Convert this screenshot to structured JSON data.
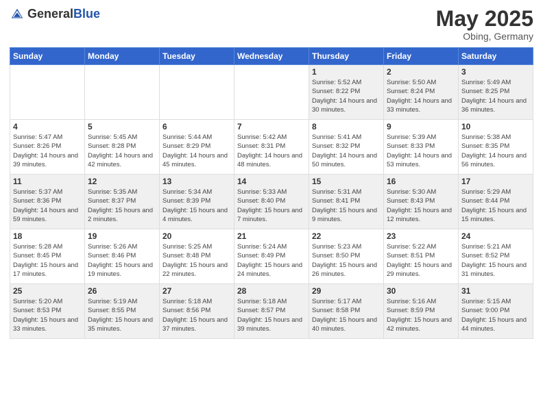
{
  "header": {
    "logo_general": "General",
    "logo_blue": "Blue",
    "month_year": "May 2025",
    "location": "Obing, Germany"
  },
  "days_of_week": [
    "Sunday",
    "Monday",
    "Tuesday",
    "Wednesday",
    "Thursday",
    "Friday",
    "Saturday"
  ],
  "weeks": [
    [
      {
        "num": "",
        "info": ""
      },
      {
        "num": "",
        "info": ""
      },
      {
        "num": "",
        "info": ""
      },
      {
        "num": "",
        "info": ""
      },
      {
        "num": "1",
        "info": "Sunrise: 5:52 AM\nSunset: 8:22 PM\nDaylight: 14 hours\nand 30 minutes."
      },
      {
        "num": "2",
        "info": "Sunrise: 5:50 AM\nSunset: 8:24 PM\nDaylight: 14 hours\nand 33 minutes."
      },
      {
        "num": "3",
        "info": "Sunrise: 5:49 AM\nSunset: 8:25 PM\nDaylight: 14 hours\nand 36 minutes."
      }
    ],
    [
      {
        "num": "4",
        "info": "Sunrise: 5:47 AM\nSunset: 8:26 PM\nDaylight: 14 hours\nand 39 minutes."
      },
      {
        "num": "5",
        "info": "Sunrise: 5:45 AM\nSunset: 8:28 PM\nDaylight: 14 hours\nand 42 minutes."
      },
      {
        "num": "6",
        "info": "Sunrise: 5:44 AM\nSunset: 8:29 PM\nDaylight: 14 hours\nand 45 minutes."
      },
      {
        "num": "7",
        "info": "Sunrise: 5:42 AM\nSunset: 8:31 PM\nDaylight: 14 hours\nand 48 minutes."
      },
      {
        "num": "8",
        "info": "Sunrise: 5:41 AM\nSunset: 8:32 PM\nDaylight: 14 hours\nand 50 minutes."
      },
      {
        "num": "9",
        "info": "Sunrise: 5:39 AM\nSunset: 8:33 PM\nDaylight: 14 hours\nand 53 minutes."
      },
      {
        "num": "10",
        "info": "Sunrise: 5:38 AM\nSunset: 8:35 PM\nDaylight: 14 hours\nand 56 minutes."
      }
    ],
    [
      {
        "num": "11",
        "info": "Sunrise: 5:37 AM\nSunset: 8:36 PM\nDaylight: 14 hours\nand 59 minutes."
      },
      {
        "num": "12",
        "info": "Sunrise: 5:35 AM\nSunset: 8:37 PM\nDaylight: 15 hours\nand 2 minutes."
      },
      {
        "num": "13",
        "info": "Sunrise: 5:34 AM\nSunset: 8:39 PM\nDaylight: 15 hours\nand 4 minutes."
      },
      {
        "num": "14",
        "info": "Sunrise: 5:33 AM\nSunset: 8:40 PM\nDaylight: 15 hours\nand 7 minutes."
      },
      {
        "num": "15",
        "info": "Sunrise: 5:31 AM\nSunset: 8:41 PM\nDaylight: 15 hours\nand 9 minutes."
      },
      {
        "num": "16",
        "info": "Sunrise: 5:30 AM\nSunset: 8:43 PM\nDaylight: 15 hours\nand 12 minutes."
      },
      {
        "num": "17",
        "info": "Sunrise: 5:29 AM\nSunset: 8:44 PM\nDaylight: 15 hours\nand 15 minutes."
      }
    ],
    [
      {
        "num": "18",
        "info": "Sunrise: 5:28 AM\nSunset: 8:45 PM\nDaylight: 15 hours\nand 17 minutes."
      },
      {
        "num": "19",
        "info": "Sunrise: 5:26 AM\nSunset: 8:46 PM\nDaylight: 15 hours\nand 19 minutes."
      },
      {
        "num": "20",
        "info": "Sunrise: 5:25 AM\nSunset: 8:48 PM\nDaylight: 15 hours\nand 22 minutes."
      },
      {
        "num": "21",
        "info": "Sunrise: 5:24 AM\nSunset: 8:49 PM\nDaylight: 15 hours\nand 24 minutes."
      },
      {
        "num": "22",
        "info": "Sunrise: 5:23 AM\nSunset: 8:50 PM\nDaylight: 15 hours\nand 26 minutes."
      },
      {
        "num": "23",
        "info": "Sunrise: 5:22 AM\nSunset: 8:51 PM\nDaylight: 15 hours\nand 29 minutes."
      },
      {
        "num": "24",
        "info": "Sunrise: 5:21 AM\nSunset: 8:52 PM\nDaylight: 15 hours\nand 31 minutes."
      }
    ],
    [
      {
        "num": "25",
        "info": "Sunrise: 5:20 AM\nSunset: 8:53 PM\nDaylight: 15 hours\nand 33 minutes."
      },
      {
        "num": "26",
        "info": "Sunrise: 5:19 AM\nSunset: 8:55 PM\nDaylight: 15 hours\nand 35 minutes."
      },
      {
        "num": "27",
        "info": "Sunrise: 5:18 AM\nSunset: 8:56 PM\nDaylight: 15 hours\nand 37 minutes."
      },
      {
        "num": "28",
        "info": "Sunrise: 5:18 AM\nSunset: 8:57 PM\nDaylight: 15 hours\nand 39 minutes."
      },
      {
        "num": "29",
        "info": "Sunrise: 5:17 AM\nSunset: 8:58 PM\nDaylight: 15 hours\nand 40 minutes."
      },
      {
        "num": "30",
        "info": "Sunrise: 5:16 AM\nSunset: 8:59 PM\nDaylight: 15 hours\nand 42 minutes."
      },
      {
        "num": "31",
        "info": "Sunrise: 5:15 AM\nSunset: 9:00 PM\nDaylight: 15 hours\nand 44 minutes."
      }
    ]
  ]
}
